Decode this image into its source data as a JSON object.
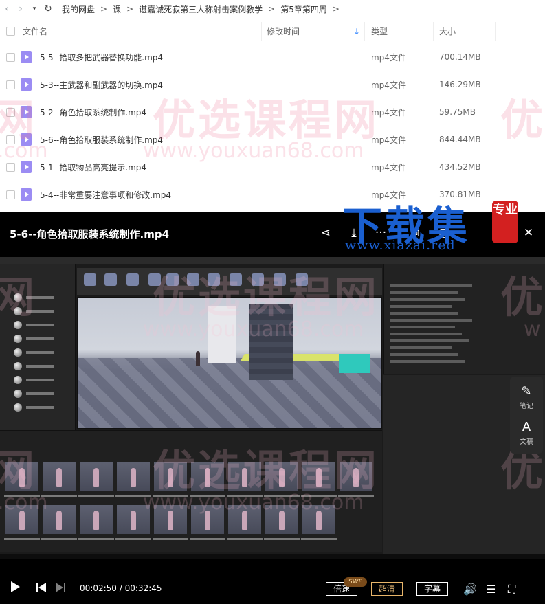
{
  "breadcrumb": {
    "back_glyph": "‹",
    "forward_glyph": "›",
    "dropdown_glyph": "▾",
    "refresh_glyph": "↻",
    "separator": ">",
    "items": [
      "我的网盘",
      "课",
      "谌嘉诚死寂第三人称射击案例教学",
      "第5章第四周"
    ],
    "trailing_separator": ">"
  },
  "list": {
    "columns": {
      "name": "文件名",
      "time": "修改时间",
      "sort_glyph": "↓",
      "type": "类型",
      "size": "大小"
    },
    "rows": [
      {
        "name": "5-5--拾取多把武器替换功能.mp4",
        "type": "mp4文件",
        "size": "700.14MB"
      },
      {
        "name": "5-3--主武器和副武器的切换.mp4",
        "type": "mp4文件",
        "size": "146.29MB"
      },
      {
        "name": "5-2--角色拾取系统制作.mp4",
        "type": "mp4文件",
        "size": "59.75MB"
      },
      {
        "name": "5-6--角色拾取服装系统制作.mp4",
        "type": "mp4文件",
        "size": "844.44MB"
      },
      {
        "name": "5-1--拾取物品高亮提示.mp4",
        "type": "mp4文件",
        "size": "434.52MB"
      },
      {
        "name": "5-4--非常重要注意事项和修改.mp4",
        "type": "mp4文件",
        "size": "370.81MB"
      }
    ]
  },
  "player": {
    "title": "5-6--角色拾取服装系统制作.mp4",
    "toolbar": {
      "share_glyph": "⋖",
      "download_glyph": "⤓",
      "more_glyph": "···",
      "pip_glyph": "⧉",
      "window_glyph": "▢",
      "minimize_glyph": "—",
      "close_glyph": "✕"
    },
    "side_panel": {
      "note_glyph": "✎",
      "note_label": "笔记",
      "doc_glyph": "A",
      "doc_label": "文稿"
    },
    "controls": {
      "current_time": "00:02:50",
      "time_separator": "/",
      "total_time": "00:32:45",
      "speed_label": "倍速",
      "swp_badge": "SWP",
      "quality_label": "超清",
      "subtitle_label": "字幕",
      "volume_glyph": "🔊",
      "playlist_glyph": "☰",
      "fullscreen_glyph": "⛶"
    }
  },
  "watermarks": {
    "site_cn": "优选课程网",
    "site_url": "www.youxuan68.com",
    "fragment_cn_left": "网",
    "fragment_cn_right": "优",
    "fragment_url": ".com",
    "fragment_url_right": "w",
    "logo_cn": "下载集",
    "logo_seal": "专业",
    "logo_url": "www.xiazai.red"
  },
  "colors": {
    "accent_blue": "#3d8cff",
    "file_icon": "#9b8cf3",
    "quality_gold": "#f1c27d",
    "watermark_pink": "#ed7896",
    "logo_blue": "#1a5fd0",
    "seal_red": "#d32020"
  }
}
